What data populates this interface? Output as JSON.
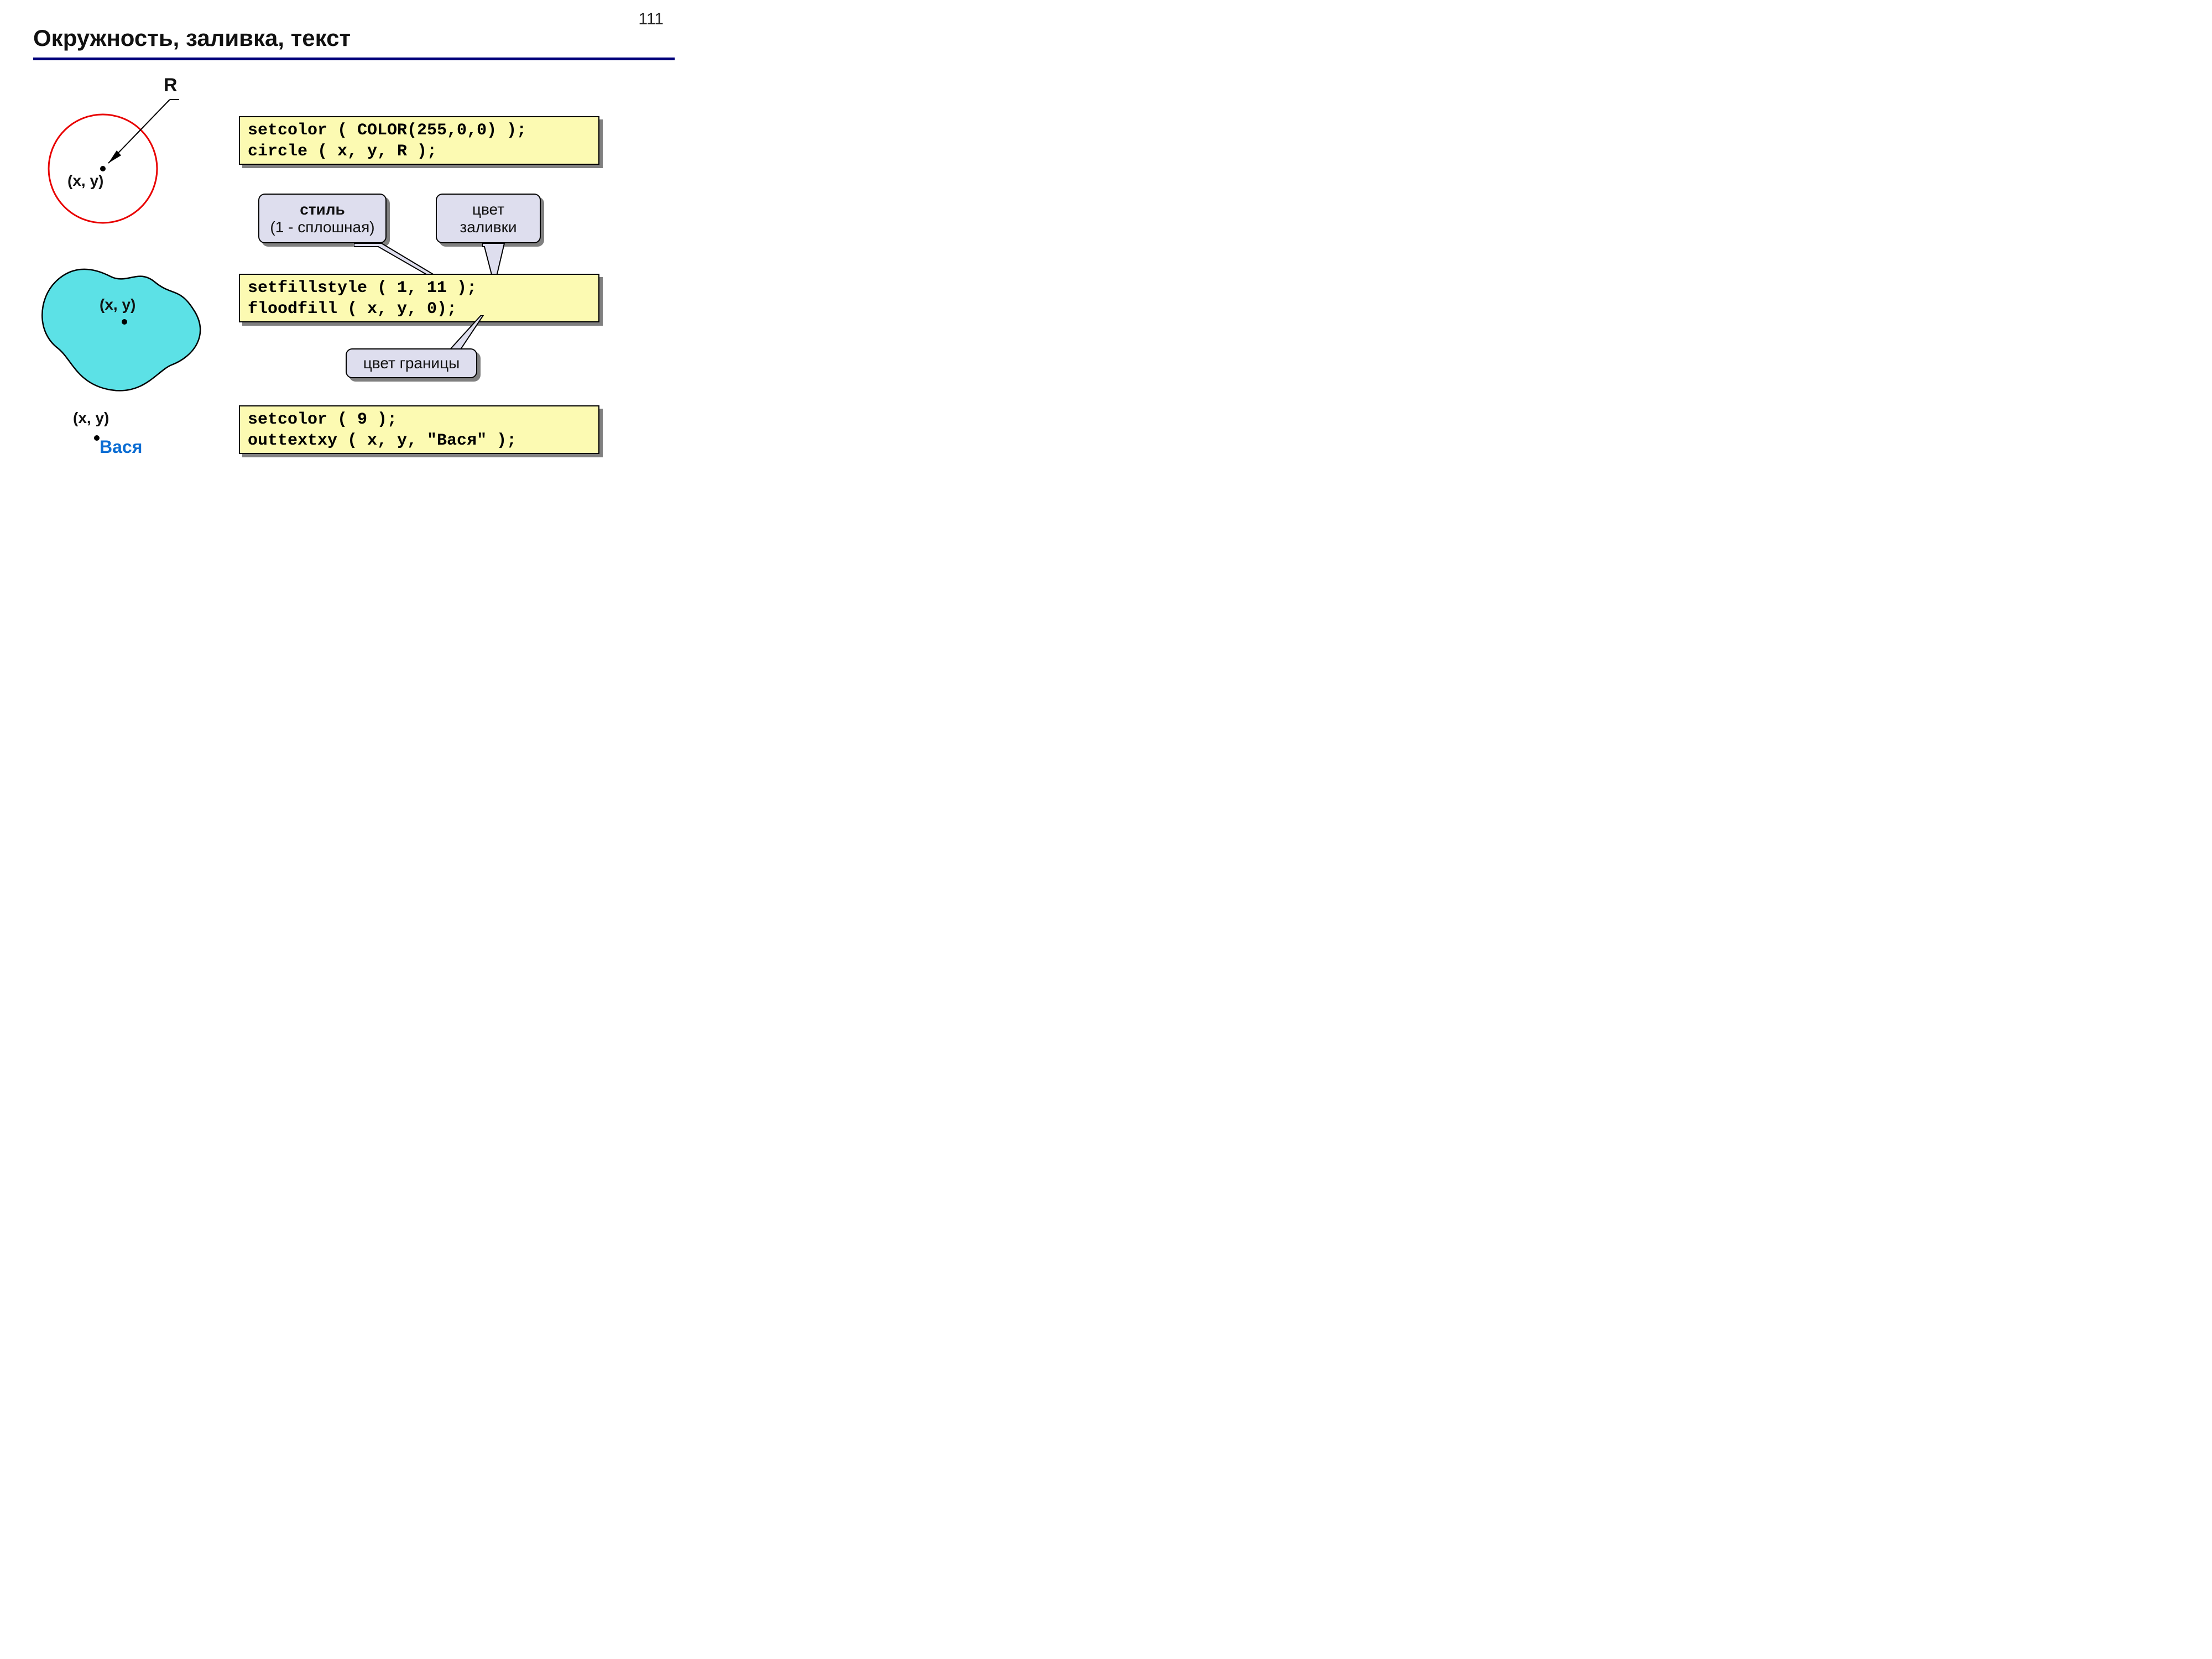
{
  "page_number": "111",
  "title": "Окружность, заливка, текст",
  "r_label": "R",
  "circle_center_label": "(x, y)",
  "blob_center_label": "(x, y)",
  "text_demo_label": "(x, y)",
  "text_demo_name": "Вася",
  "code1": "setcolor ( COLOR(255,0,0) );\ncircle ( x, y, R );",
  "code2": "setfillstyle ( 1, 11 );\nfloodfill ( x, y, 0);",
  "code3": "setcolor ( 9 );\nouttextxy ( x, y, \"Вася\" );",
  "callout_style_bold": "стиль",
  "callout_style_plain": "(1 - сплошная)",
  "callout_fillcolor_l1": "цвет",
  "callout_fillcolor_l2": "заливки",
  "callout_border": "цвет границы"
}
